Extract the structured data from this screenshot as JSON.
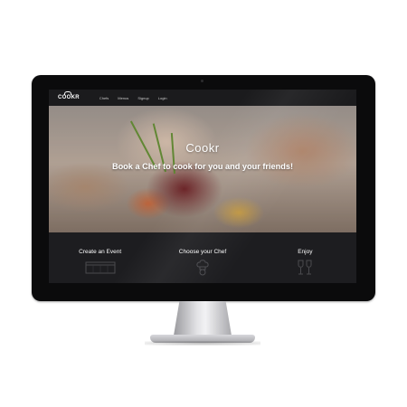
{
  "navbar": {
    "logo": "COOKR",
    "links": [
      "Chefs",
      "Menus",
      "Signup",
      "Login"
    ]
  },
  "hero": {
    "title": "Cookr",
    "subtitle": "Book a Chef to cook for you and your friends!"
  },
  "features": [
    {
      "label": "Create an Event",
      "icon": "calendar-icon"
    },
    {
      "label": "Choose your Chef",
      "icon": "chef-hat-icon"
    },
    {
      "label": "Enjoy",
      "icon": "wine-glasses-icon"
    }
  ]
}
